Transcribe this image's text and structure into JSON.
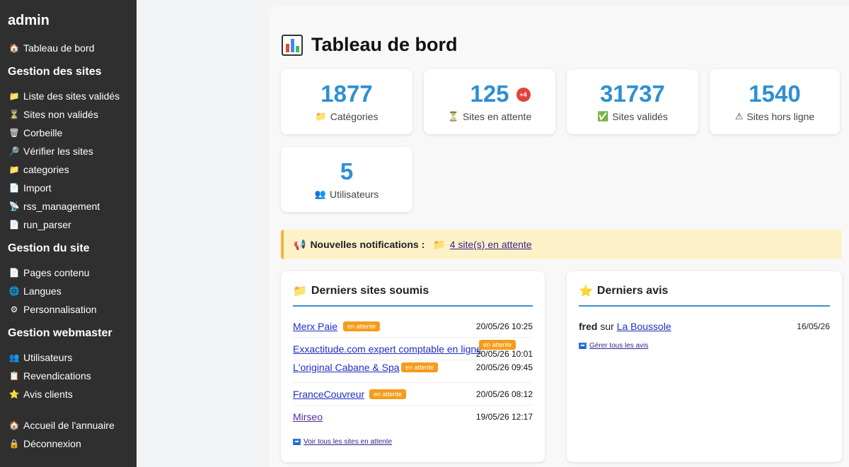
{
  "sidebar": {
    "title": "admin",
    "items_top": [
      {
        "icon": "🏠",
        "label": "Tableau de bord"
      }
    ],
    "section1": "Gestion des sites",
    "items1": [
      {
        "icon": "📁",
        "label": "Liste des sites validés"
      },
      {
        "icon": "⏳",
        "label": "Sites non validés"
      },
      {
        "icon": "🗑",
        "label": "Corbeille"
      },
      {
        "icon": "🔎",
        "label": "Vérifier les sites"
      },
      {
        "icon": "📁",
        "label": "categories"
      },
      {
        "icon": "📄",
        "label": "Import"
      },
      {
        "icon": "📡",
        "label": "rss_management"
      },
      {
        "icon": "📄",
        "label": "run_parser"
      }
    ],
    "section2": "Gestion du site",
    "items2": [
      {
        "icon": "📄",
        "label": "Pages contenu"
      },
      {
        "icon": "🌐",
        "label": "Langues"
      },
      {
        "icon": "⚙",
        "label": "Personnalisation"
      }
    ],
    "section3": "Gestion webmaster",
    "items3": [
      {
        "icon": "👥",
        "label": "Utilisateurs"
      },
      {
        "icon": "📋",
        "label": "Revendications"
      },
      {
        "icon": "⭐",
        "label": "Avis clients"
      }
    ],
    "items_bottom": [
      {
        "icon": "🏠",
        "label": "Accueil de l'annuaire"
      },
      {
        "icon": "🔒",
        "label": "Déconnexion"
      }
    ]
  },
  "page": {
    "title": "Tableau de bord"
  },
  "stats": [
    {
      "value": "1877",
      "icon": "📁",
      "label": "Catégories"
    },
    {
      "value": "125",
      "icon": "⏳",
      "label": "Sites en attente",
      "badge": "+4"
    },
    {
      "value": "31737",
      "icon": "✅",
      "label": "Sites validés"
    },
    {
      "value": "1540",
      "icon": "⚠",
      "label": "Sites hors ligne"
    },
    {
      "value": "5",
      "icon": "👥",
      "label": "Utilisateurs"
    }
  ],
  "notification": {
    "icon": "📢",
    "label": "Nouvelles notifications :",
    "link_icon": "📁",
    "link_text": "4 site(s) en attente"
  },
  "recent_sites": {
    "icon": "📁",
    "title": "Derniers sites soumis",
    "rows": [
      {
        "name": "Merx Paie",
        "badge": "en attente",
        "date": "20/05/26 10:25"
      },
      {
        "name": "Exxactitude.com expert comptable en ligne",
        "badge": "en attente",
        "date": "20/05/26 10:01"
      },
      {
        "name": "L'original Cabane & Spa",
        "badge": "en attente",
        "date": "20/05/26 09:45"
      },
      {
        "name": "FranceCouvreur",
        "badge": "en attente",
        "date": "20/05/26 08:12"
      },
      {
        "name": "Mirseo",
        "badge": "",
        "date": "19/05/26 12:17"
      }
    ],
    "footer_link": "Voir tous les sites en attente"
  },
  "recent_reviews": {
    "icon": "⭐",
    "title": "Derniers avis",
    "rows": [
      {
        "user": "fred",
        "sep": "sur",
        "site": "La Boussole",
        "date": "16/05/26"
      }
    ],
    "footer_link": "Gérer tous les avis"
  },
  "colors": {
    "accent": "#2e8fd4",
    "sidebar": "#2f2f2f",
    "badge": "#f59c1a",
    "notif_bg": "#fdf1c8"
  }
}
